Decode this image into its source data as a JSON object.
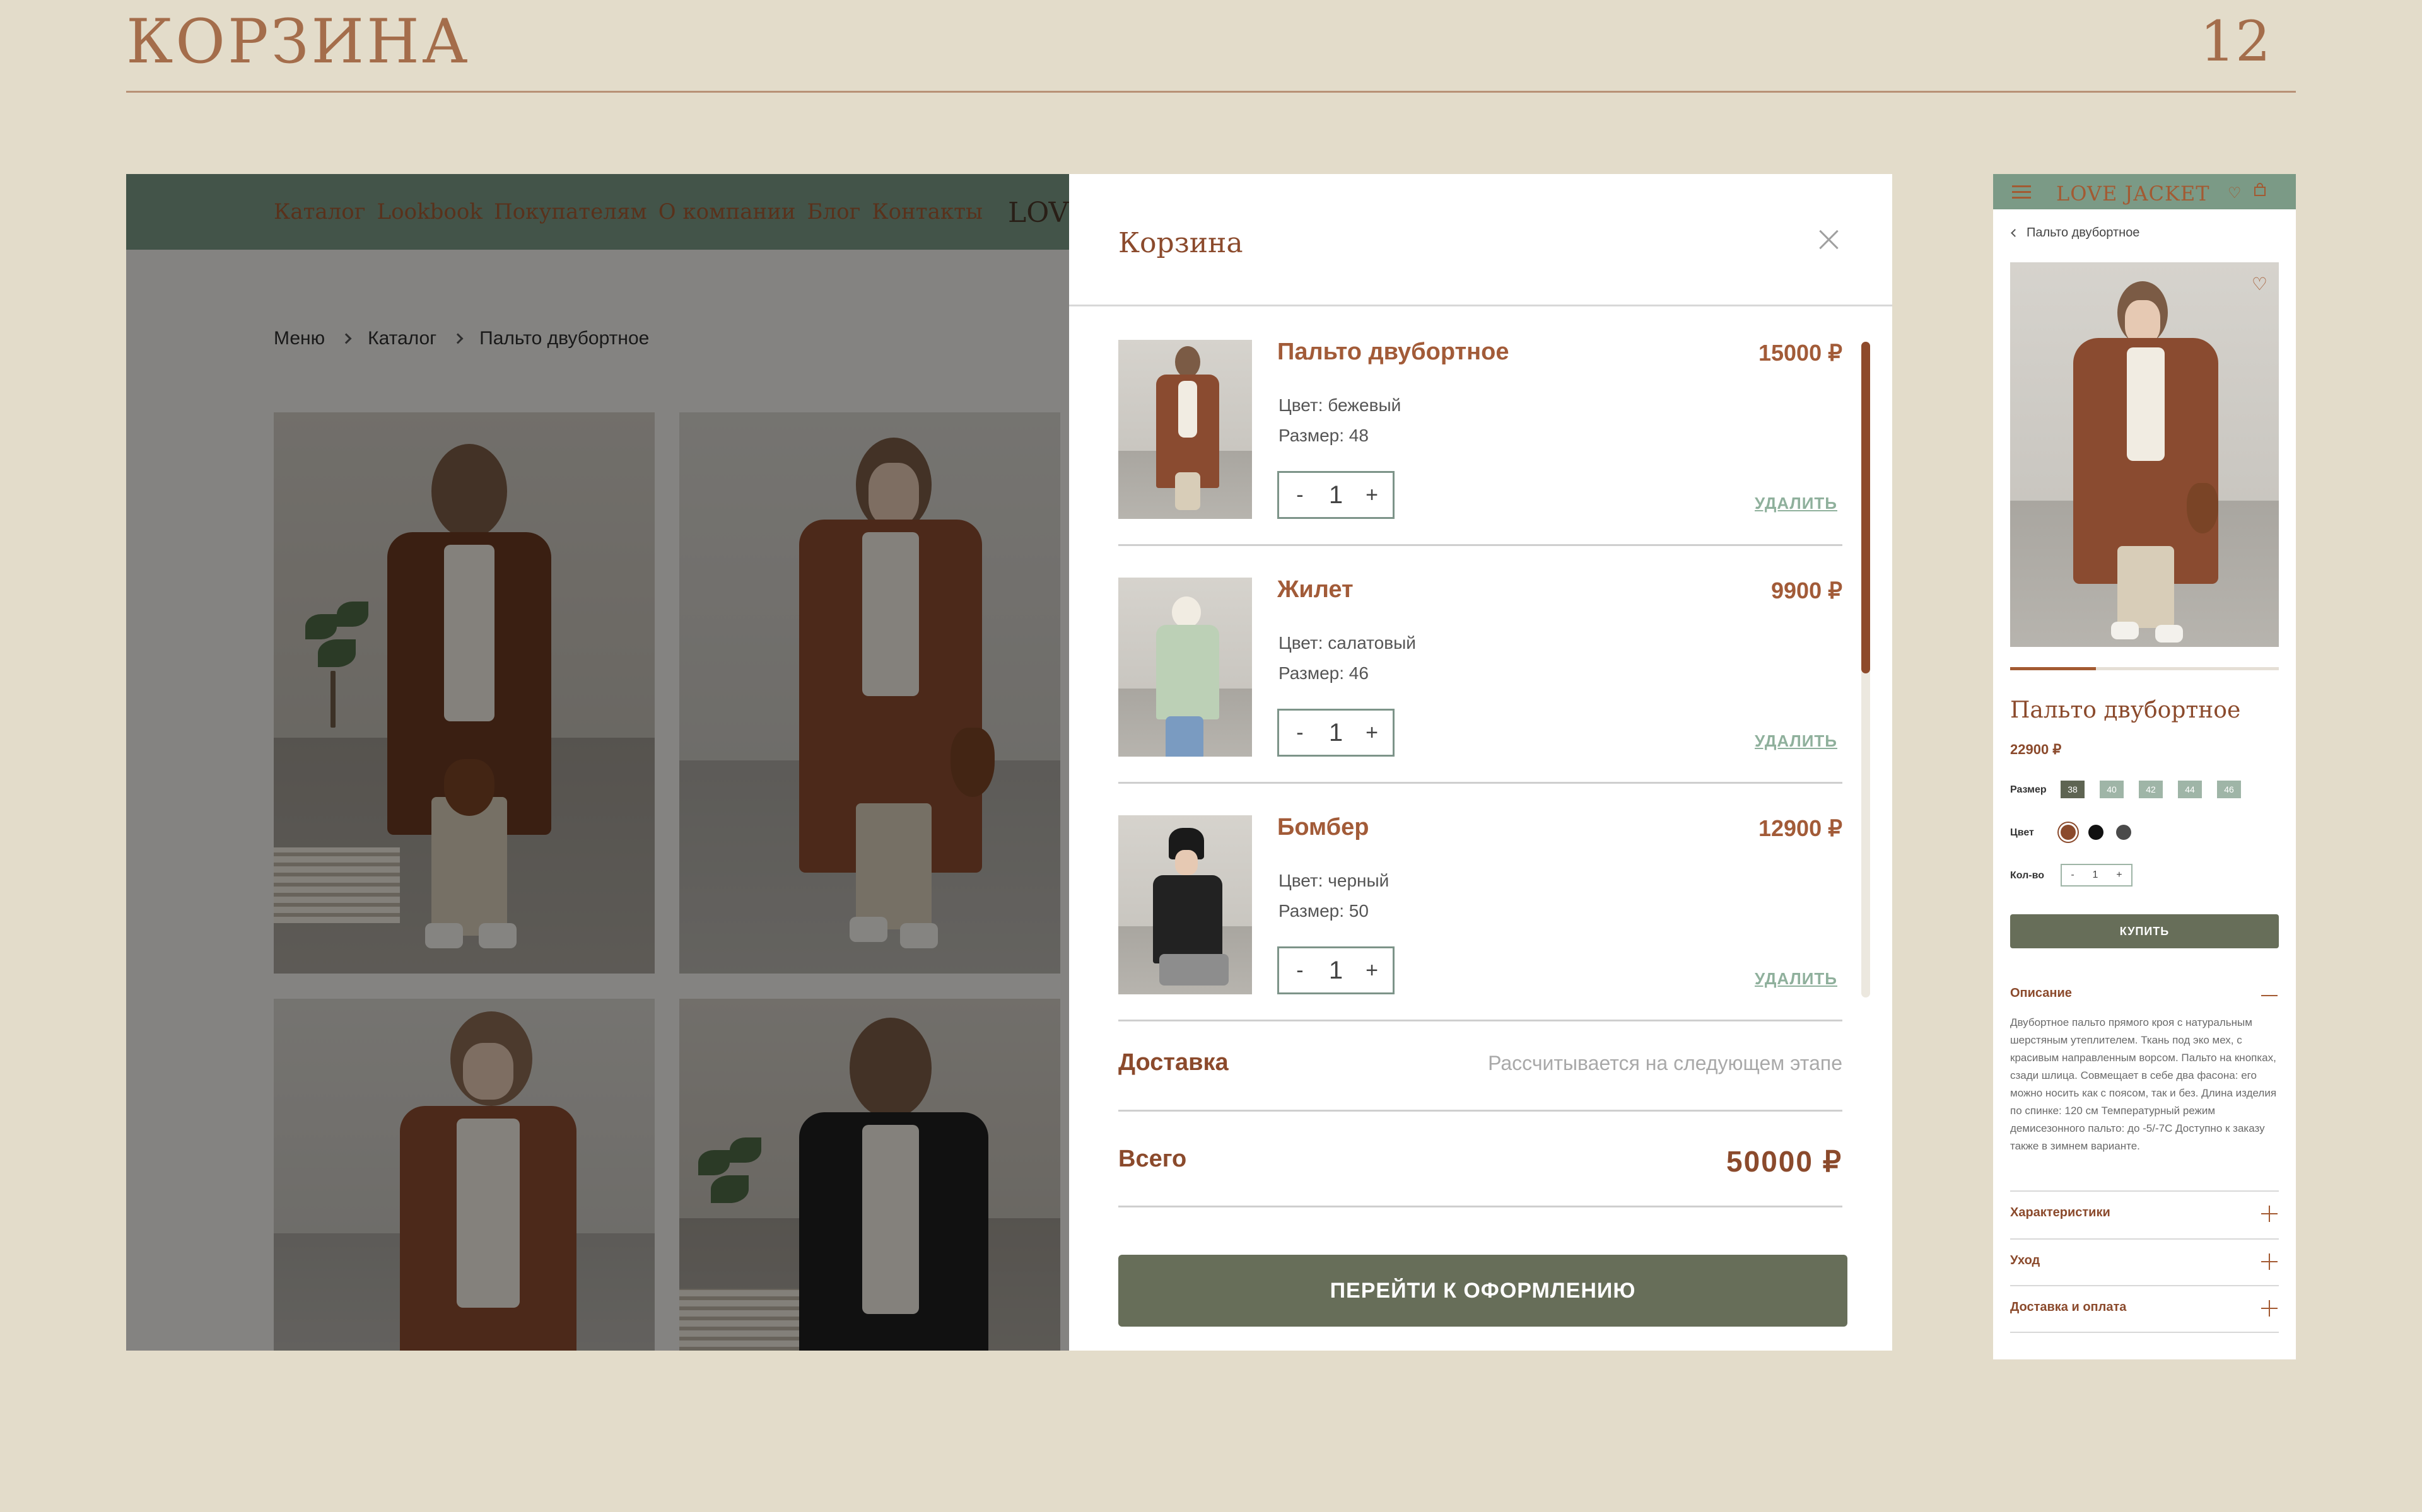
{
  "slide": {
    "title": "КОРЗИНА",
    "number": "12"
  },
  "site": {
    "nav": [
      "Каталог",
      "Lookbook",
      "Покупателям",
      "О компании",
      "Блог",
      "Контакты"
    ],
    "logo": "LOVE",
    "breadcrumbs": [
      "Меню",
      "Каталог",
      "Пальто двубортное"
    ]
  },
  "cart": {
    "title": "Корзина",
    "items": [
      {
        "name": "Пальто двубортное",
        "price": "15000 ₽",
        "color": "Цвет: бежевый",
        "size": "Размер: 48",
        "qty": "1",
        "remove": "УДАЛИТЬ"
      },
      {
        "name": "Жилет",
        "price": "9900 ₽",
        "color": "Цвет: салатовый",
        "size": "Размер: 46",
        "qty": "1",
        "remove": "УДАЛИТЬ"
      },
      {
        "name": "Бомбер",
        "price": "12900 ₽",
        "color": "Цвет: черный",
        "size": "Размер: 50",
        "qty": "1",
        "remove": "УДАЛИТЬ"
      }
    ],
    "qty_minus": "-",
    "qty_plus": "+",
    "delivery_label": "Доставка",
    "delivery_note": "Рассчитывается на следующем этапе",
    "total_label": "Всего",
    "total_value": "50000 ₽",
    "checkout_label": "ПЕРЕЙТИ К ОФОРМЛЕНИЮ"
  },
  "mobile": {
    "logo": "LOVE JACKET",
    "back_label": "Пальто двубортное",
    "gallery_progress": 0.32,
    "product_title": "Пальто двубортное",
    "price": "22900 ₽",
    "size_label": "Размер",
    "sizes": [
      "38",
      "40",
      "42",
      "44",
      "46"
    ],
    "selected_size": "38",
    "color_label": "Цвет",
    "colors": [
      "#8b4a2c",
      "#111111",
      "#4a4a4a"
    ],
    "qty_label": "Кол-во",
    "qty": "1",
    "qty_minus": "-",
    "qty_plus": "+",
    "buy_label": "КУПИТЬ",
    "description_heading": "Описание",
    "description_text": "Двубортное пальто прямого кроя с натуральным шерстяным утеплителем. Ткань под эко мех, с красивым направленным ворсом. Пальто на кнопках, сзади шлица. Совмещает в себе два фасона: его можно носить как с поясом, так и без. Длина изделия по спинке: 120 см Температурный режим демисезонного пальто: до -5/-7С Доступно к заказу также в зимнем варианте.",
    "accordions": [
      "Характеристики",
      "Уход",
      "Доставка и оплата"
    ]
  },
  "colors": {
    "background": "#e3dcca",
    "accent": "#a46d4b",
    "brand_green": "#7b9a86",
    "button": "#676e59"
  }
}
